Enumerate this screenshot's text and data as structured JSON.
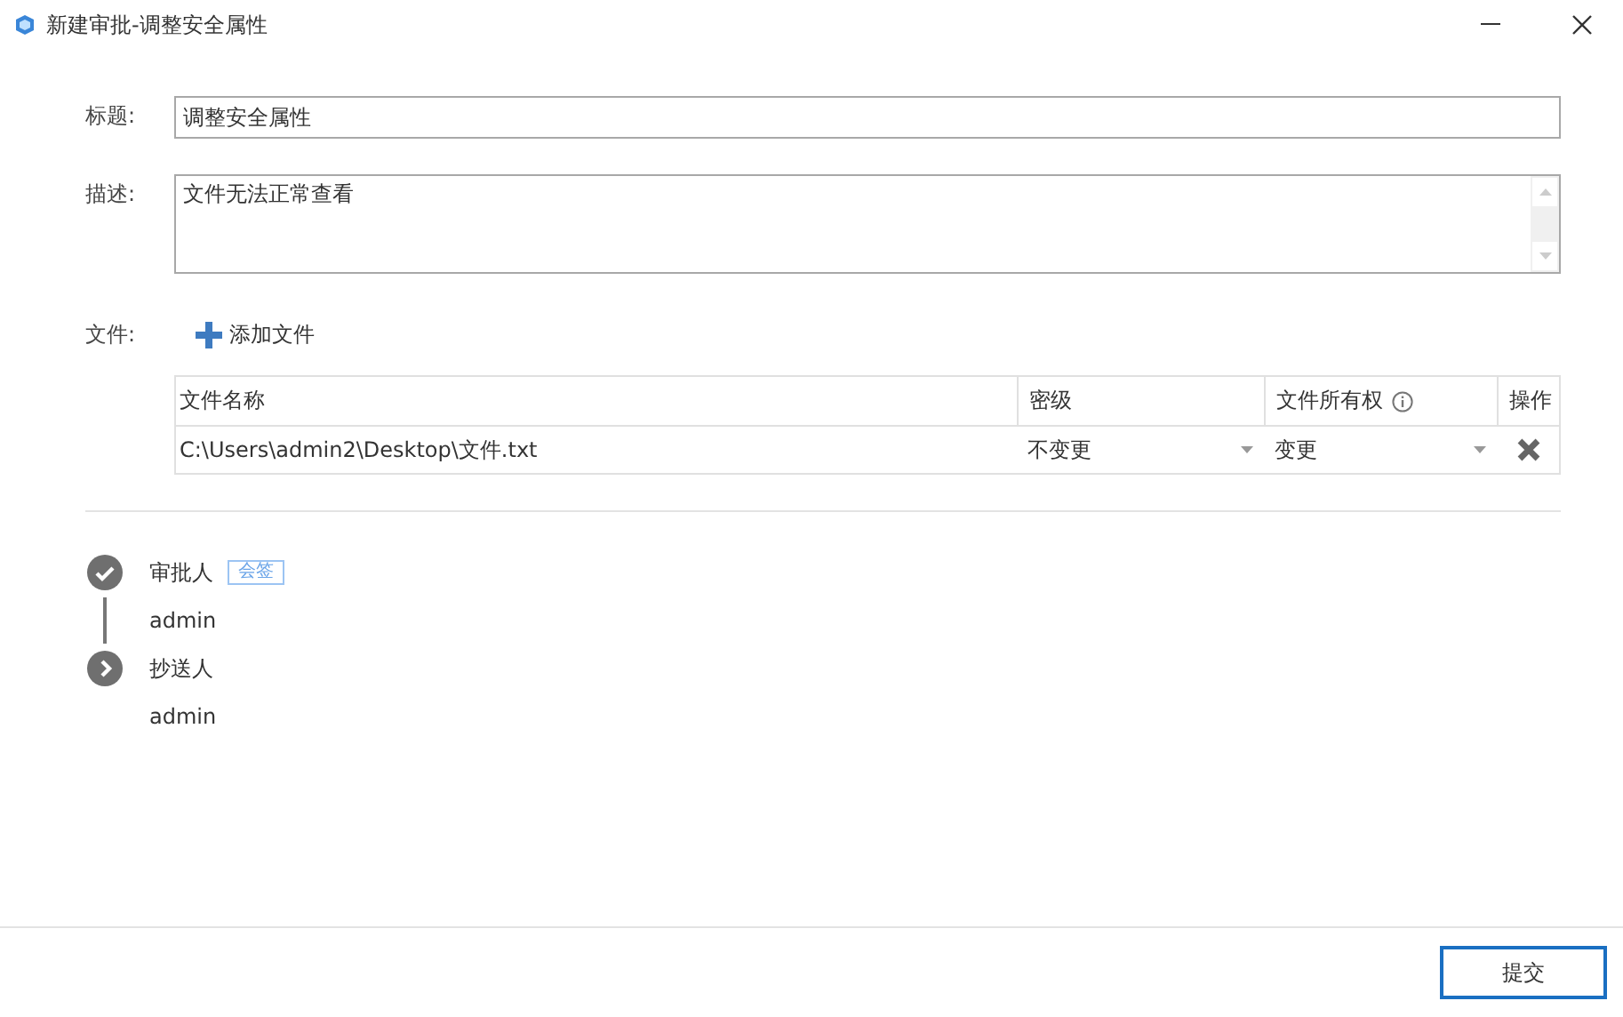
{
  "window": {
    "title": "新建审批-调整安全属性"
  },
  "form": {
    "title_label": "标题:",
    "title_value": "调整安全属性",
    "description_label": "描述:",
    "description_value": "文件无法正常查看",
    "files_label": "文件:",
    "add_file": "添加文件"
  },
  "table": {
    "columns": [
      "文件名称",
      "密级",
      "文件所有权",
      "操作"
    ],
    "rows": [
      {
        "name": "C:\\Users\\admin2\\Desktop\\文件.txt",
        "level": "不变更",
        "ownership": "变更"
      }
    ]
  },
  "flow": [
    {
      "kind": "approver",
      "label": "审批人",
      "tag": "会签",
      "people": [
        "admin"
      ]
    },
    {
      "kind": "cc",
      "label": "抄送人",
      "people": [
        "admin"
      ]
    }
  ],
  "buttons": [
    "提交"
  ]
}
